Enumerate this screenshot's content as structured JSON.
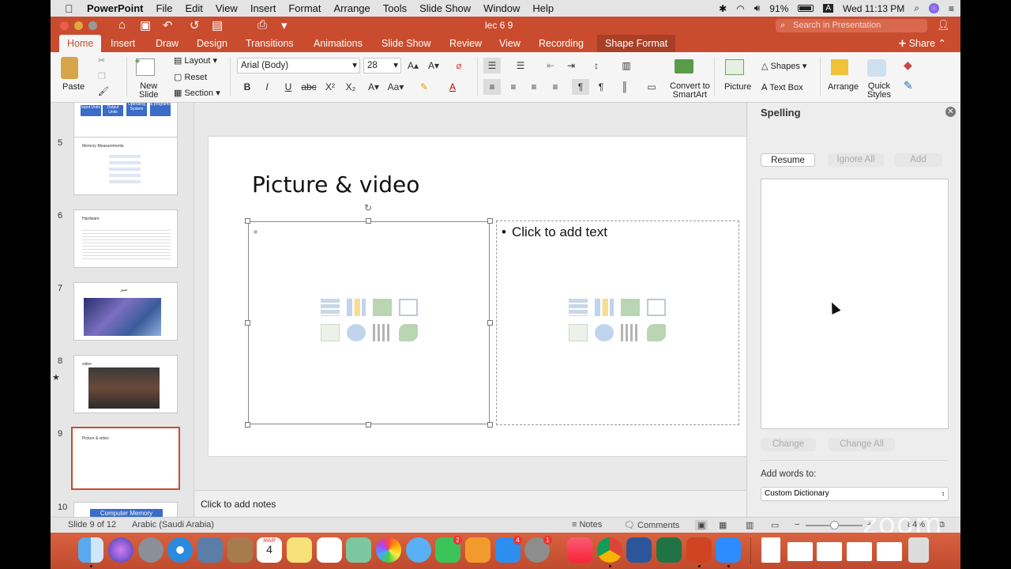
{
  "menubar": {
    "app": "PowerPoint",
    "items": [
      "File",
      "Edit",
      "View",
      "Insert",
      "Format",
      "Arrange",
      "Tools",
      "Slide Show",
      "Window",
      "Help"
    ],
    "battery": "91%",
    "clock": "Wed 11:13 PM",
    "input_source": "A"
  },
  "window": {
    "title": "lec 6 9",
    "search_placeholder": "Search in Presentation"
  },
  "ribbon": {
    "tabs": [
      "Home",
      "Insert",
      "Draw",
      "Design",
      "Transitions",
      "Animations",
      "Slide Show",
      "Review",
      "View",
      "Recording",
      "Shape Format"
    ],
    "active_tab": "Home",
    "share": "Share",
    "paste": "Paste",
    "new_slide": "New\nSlide",
    "layout": "Layout",
    "reset": "Reset",
    "section": "Section",
    "font": "Arial (Body)",
    "font_size": "28",
    "convert": "Convert to\nSmartArt",
    "picture": "Picture",
    "shapes": "Shapes",
    "text_box": "Text Box",
    "arrange": "Arrange",
    "quick_styles": "Quick\nStyles"
  },
  "thumbnails": [
    {
      "num": "5",
      "title": "Memory Measurements"
    },
    {
      "num": "6",
      "title": "Hardware"
    },
    {
      "num": "7",
      "title": "صور"
    },
    {
      "num": "8",
      "title": "video"
    },
    {
      "num": "9",
      "title": "Picture & video",
      "selected": true
    },
    {
      "num": "10",
      "title": "Computer Memory"
    }
  ],
  "thumb4_boxes": [
    "Input Units",
    "Output Units",
    "Operating System",
    "& programs"
  ],
  "slide": {
    "title": "Picture & video",
    "placeholder_text": "Click to add text"
  },
  "notes": "Click to add notes",
  "spelling": {
    "title": "Spelling",
    "resume": "Resume",
    "ignore_all": "Ignore All",
    "add": "Add",
    "change": "Change",
    "change_all": "Change All",
    "add_words_to": "Add words to:",
    "dictionary": "Custom Dictionary"
  },
  "status": {
    "slide_of": "Slide 9 of 12",
    "language": "Arabic (Saudi Arabia)",
    "notes": "Notes",
    "comments": "Comments",
    "zoom": "84%"
  },
  "dock": {
    "calendar_month": "MAR",
    "calendar_day": "4",
    "facetime_badge": "2",
    "appstore_badge": "4",
    "prefs_badge": "1"
  },
  "watermark": "zoom",
  "colors": {
    "accent": "#c94c2f",
    "selected_border": "#c94c2f"
  }
}
